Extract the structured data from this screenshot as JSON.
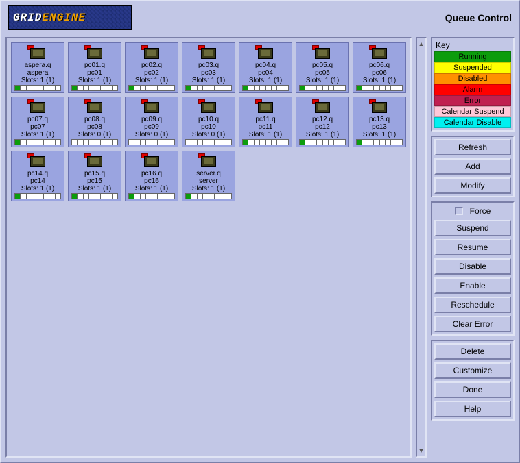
{
  "header": {
    "logo_text1": "GRID",
    "logo_text2": "ENGINE",
    "title": "Queue Control"
  },
  "key": {
    "title": "Key",
    "items": [
      {
        "label": "Running",
        "bg": "#0c9c0c",
        "fg": "#000"
      },
      {
        "label": "Suspended",
        "bg": "#ffff00",
        "fg": "#000"
      },
      {
        "label": "Disabled",
        "bg": "#ff9000",
        "fg": "#000"
      },
      {
        "label": "Alarm",
        "bg": "#ff0000",
        "fg": "#000"
      },
      {
        "label": "Error",
        "bg": "#c02050",
        "fg": "#000"
      },
      {
        "label": "Calendar Suspend",
        "bg": "#ffc8d8",
        "fg": "#000"
      },
      {
        "label": "Calendar Disable",
        "bg": "#00f0f0",
        "fg": "#000"
      }
    ]
  },
  "buttons_top": [
    "Refresh",
    "Add",
    "Modify"
  ],
  "force_label": "Force",
  "buttons_mid": [
    "Suspend",
    "Resume",
    "Disable",
    "Enable",
    "Reschedule",
    "Clear Error"
  ],
  "buttons_bot": [
    "Delete",
    "Customize",
    "Done",
    "Help"
  ],
  "queues": [
    {
      "q": "aspera.q",
      "h": "aspera",
      "slots": "Slots: 1 (1)",
      "busy": 1
    },
    {
      "q": "pc01.q",
      "h": "pc01",
      "slots": "Slots: 1 (1)",
      "busy": 1
    },
    {
      "q": "pc02.q",
      "h": "pc02",
      "slots": "Slots: 1 (1)",
      "busy": 1
    },
    {
      "q": "pc03.q",
      "h": "pc03",
      "slots": "Slots: 1 (1)",
      "busy": 1
    },
    {
      "q": "pc04.q",
      "h": "pc04",
      "slots": "Slots: 1 (1)",
      "busy": 1
    },
    {
      "q": "pc05.q",
      "h": "pc05",
      "slots": "Slots: 1 (1)",
      "busy": 1
    },
    {
      "q": "pc06.q",
      "h": "pc06",
      "slots": "Slots: 1 (1)",
      "busy": 1
    },
    {
      "q": "pc07.q",
      "h": "pc07",
      "slots": "Slots: 1 (1)",
      "busy": 1
    },
    {
      "q": "pc08.q",
      "h": "pc08",
      "slots": "Slots: 0 (1)",
      "busy": 0
    },
    {
      "q": "pc09.q",
      "h": "pc09",
      "slots": "Slots: 0 (1)",
      "busy": 0
    },
    {
      "q": "pc10.q",
      "h": "pc10",
      "slots": "Slots: 0 (1)",
      "busy": 0
    },
    {
      "q": "pc11.q",
      "h": "pc11",
      "slots": "Slots: 1 (1)",
      "busy": 1
    },
    {
      "q": "pc12.q",
      "h": "pc12",
      "slots": "Slots: 1 (1)",
      "busy": 1
    },
    {
      "q": "pc13.q",
      "h": "pc13",
      "slots": "Slots: 1 (1)",
      "busy": 1
    },
    {
      "q": "pc14.q",
      "h": "pc14",
      "slots": "Slots: 1 (1)",
      "busy": 1
    },
    {
      "q": "pc15.q",
      "h": "pc15",
      "slots": "Slots: 1 (1)",
      "busy": 1
    },
    {
      "q": "pc16.q",
      "h": "pc16",
      "slots": "Slots: 1 (1)",
      "busy": 1
    },
    {
      "q": "server.q",
      "h": "server",
      "slots": "Slots: 1 (1)",
      "busy": 1
    }
  ]
}
